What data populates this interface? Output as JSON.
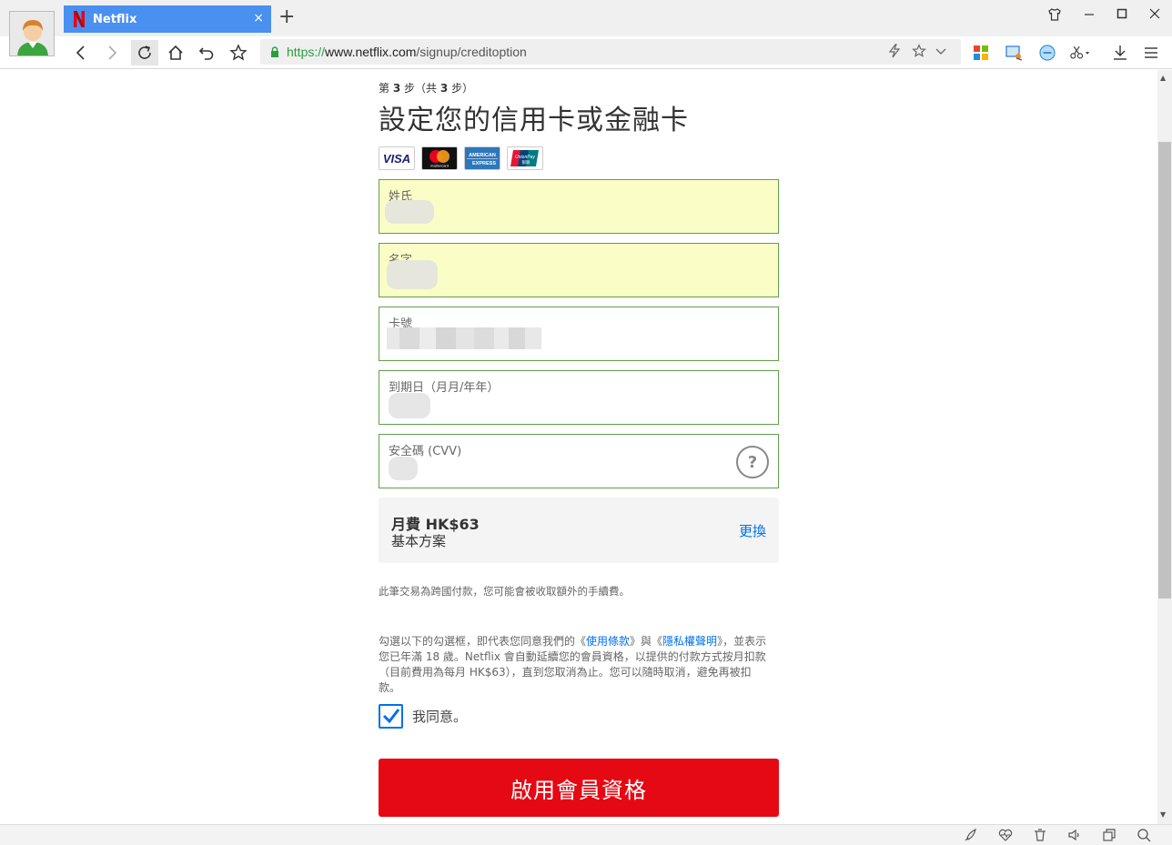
{
  "browser": {
    "tab_title": "Netflix",
    "tab_close": "×",
    "new_tab": "+",
    "url_protocol": "https://",
    "url_host": "www.netflix.com",
    "url_path": "/signup/creditoption"
  },
  "page": {
    "step_prefix": "第",
    "step_current": "3",
    "step_middle": "步（共",
    "step_total": "3",
    "step_suffix": "步）",
    "title": "設定您的信用卡或金融卡",
    "card_brands": [
      "VISA",
      "mastercard",
      "AMERICAN EXPRESS",
      "UnionPay 银联"
    ],
    "fields": {
      "last_name_label": "姓氏",
      "first_name_label": "名字",
      "card_number_label": "卡號",
      "expiry_label": "到期日（月月/年年）",
      "cvv_label": "安全碼 (CVV)",
      "cvv_help": "?"
    },
    "plan": {
      "price": "月費 HK$63",
      "name": "基本方案",
      "change": "更換"
    },
    "notice": "此筆交易為跨國付款，您可能會被收取額外的手續費。",
    "terms": {
      "part1": "勾選以下的勾選框，即代表您同意我們的《",
      "link1": "使用條款",
      "part2": "》與《",
      "link2": "隱私權聲明",
      "part3": "》，並表示您已年滿 18 歲。Netflix 會自動延續您的會員資格，以提供的付款方式按月扣款（目前費用為每月 HK$63），直到您取消為止。您可以隨時取消，避免再被扣款。"
    },
    "agree_label": "我同意。",
    "agree_checked": true,
    "submit": "啟用會員資格"
  },
  "colors": {
    "accent_red": "#e50914",
    "link_blue": "#0071eb",
    "field_border": "#5fa14a",
    "autofill_bg": "#fafdc6",
    "tab_blue": "#4a90f0"
  }
}
